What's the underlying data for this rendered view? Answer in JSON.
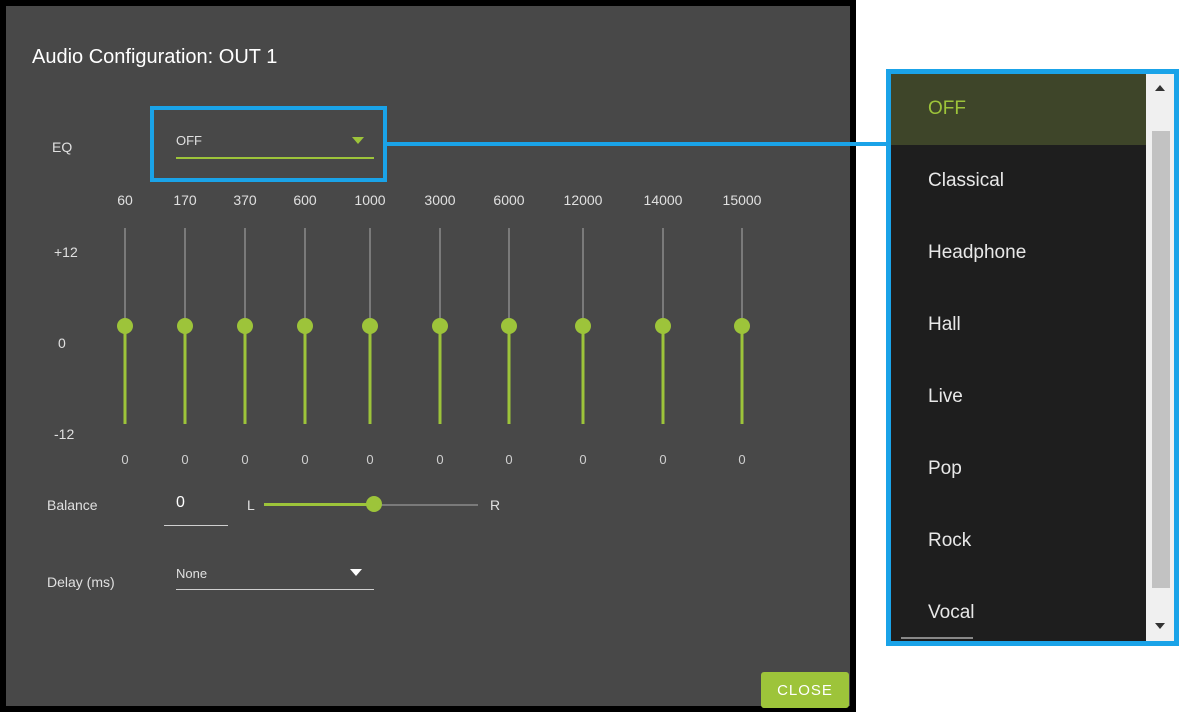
{
  "dialog": {
    "title": "Audio Configuration: OUT 1",
    "close_label": "CLOSE"
  },
  "eq": {
    "label": "EQ",
    "selected": "OFF",
    "frequencies": [
      "60",
      "170",
      "370",
      "600",
      "1000",
      "3000",
      "6000",
      "12000",
      "14000",
      "15000"
    ],
    "gains": [
      "0",
      "0",
      "0",
      "0",
      "0",
      "0",
      "0",
      "0",
      "0",
      "0"
    ],
    "scale": {
      "top": "+12",
      "mid": "0",
      "bottom": "-12"
    }
  },
  "balance": {
    "label": "Balance",
    "value": "0",
    "left_label": "L",
    "right_label": "R"
  },
  "delay": {
    "label": "Delay (ms)",
    "value": "None"
  },
  "dropdown": {
    "options": [
      "OFF",
      "Classical",
      "Headphone",
      "Hall",
      "Live",
      "Pop",
      "Rock",
      "Vocal"
    ],
    "selected_index": 0
  },
  "colors": {
    "accent": "#9dc43a",
    "highlight": "#1aa3e8",
    "panel": "#484848"
  }
}
